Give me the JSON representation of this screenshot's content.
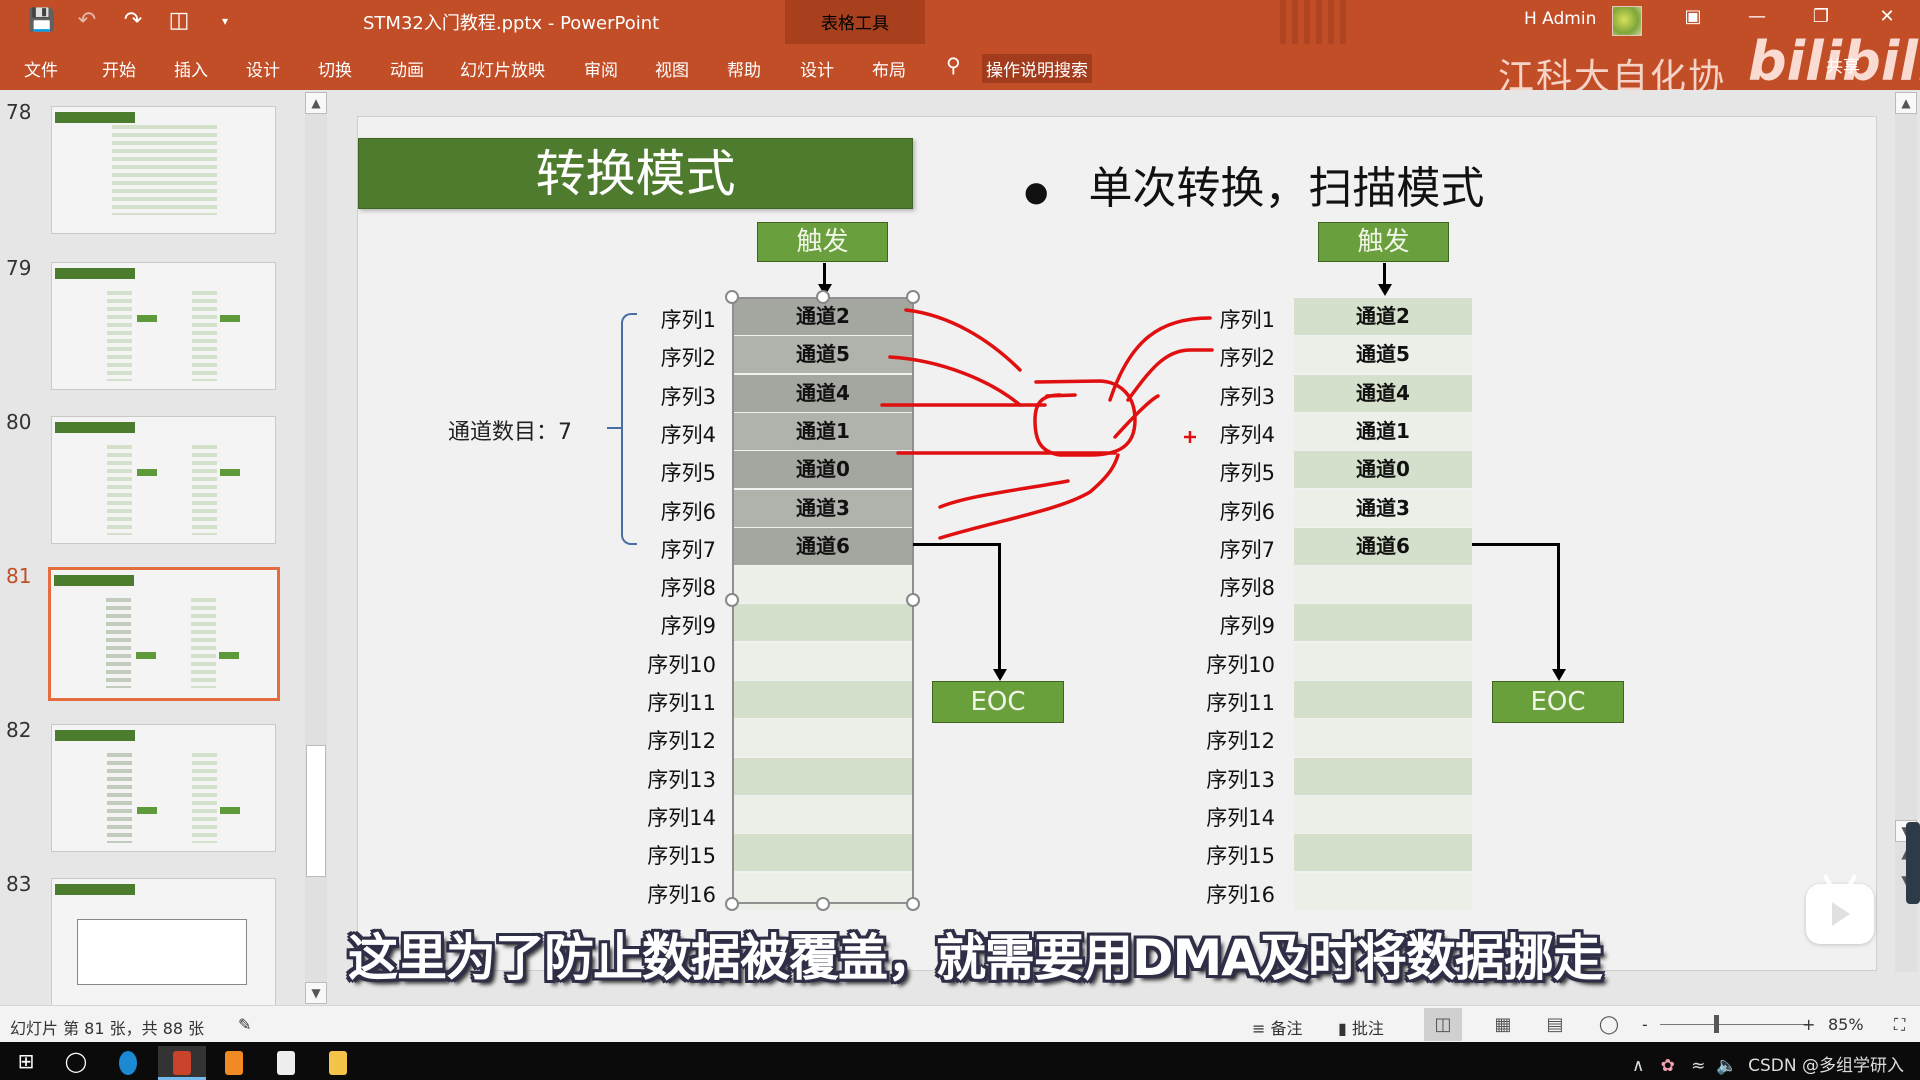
{
  "app": {
    "document_title": "STM32入门教程.pptx  -  PowerPoint",
    "context_tool_group": "表格工具",
    "user_name": "H Admin",
    "window_controls": [
      "ribbon-display-icon",
      "minimize-icon",
      "restore-icon",
      "close-icon"
    ],
    "quick_access": [
      "save-icon",
      "undo-icon",
      "redo-icon",
      "present-from-start-icon",
      "customize-qat-icon"
    ]
  },
  "ribbon": {
    "tabs": [
      "文件",
      "开始",
      "插入",
      "设计",
      "切换",
      "动画",
      "幻灯片放映",
      "审阅",
      "视图",
      "帮助",
      "设计",
      "布局"
    ],
    "search_label": "操作说明搜索",
    "share_label": "共享"
  },
  "overlay": {
    "watermark_text": "江科大自化协",
    "platform_logo": "bilibili",
    "subtitle": "这里为了防止数据被覆盖，就需要用DMA及时将数据挪走"
  },
  "thumbnails": {
    "slides": [
      {
        "number": "78",
        "active": false
      },
      {
        "number": "79",
        "active": false
      },
      {
        "number": "80",
        "active": false
      },
      {
        "number": "81",
        "active": true
      },
      {
        "number": "82",
        "active": false
      },
      {
        "number": "83",
        "active": false
      }
    ]
  },
  "slide": {
    "title": "转换模式",
    "bullet": "单次转换，扫描模式",
    "channel_count_label": "通道数目：7",
    "left_diagram": {
      "trigger": "触发",
      "eoc": "EOC",
      "sequence_labels": [
        "序列1",
        "序列2",
        "序列3",
        "序列4",
        "序列5",
        "序列6",
        "序列7",
        "序列8",
        "序列9",
        "序列10",
        "序列11",
        "序列12",
        "序列13",
        "序列14",
        "序列15",
        "序列16"
      ],
      "channels": [
        "通道2",
        "通道5",
        "通道4",
        "通道1",
        "通道0",
        "通道3",
        "通道6",
        "",
        "",
        "",
        "",
        "",
        "",
        "",
        "",
        ""
      ]
    },
    "right_diagram": {
      "trigger": "触发",
      "eoc": "EOC",
      "sequence_labels": [
        "序列1",
        "序列2",
        "序列3",
        "序列4",
        "序列5",
        "序列6",
        "序列7",
        "序列8",
        "序列9",
        "序列10",
        "序列11",
        "序列12",
        "序列13",
        "序列14",
        "序列15",
        "序列16"
      ],
      "channels": [
        "通道2",
        "通道5",
        "通道4",
        "通道1",
        "通道0",
        "通道3",
        "通道6",
        "",
        "",
        "",
        "",
        "",
        "",
        "",
        "",
        ""
      ]
    }
  },
  "statusbar": {
    "slide_info": "幻灯片 第 81 张，共 88 张",
    "notes_label": "备注",
    "comments_label": "批注",
    "zoom_level": "85%",
    "zoom_minus": "-",
    "zoom_plus": "+"
  },
  "taskbar": {
    "apps": [
      "start-icon",
      "search-icon",
      "edge-icon",
      "powerpoint-icon",
      "app-orange-icon",
      "photos-icon",
      "file-explorer-icon"
    ],
    "tray_text": "CSDN @多组学研入"
  },
  "colors": {
    "ribbon": "#c24e27",
    "slide_title_bg": "#4e7b2d",
    "box_green": "#6a9f3d",
    "selection_gray": "#a4a79f",
    "row_green_dark": "#d4e0cc",
    "row_green_light": "#eaefe7",
    "ink_red": "#e01010",
    "active_thumb_border": "#e46c3f"
  }
}
